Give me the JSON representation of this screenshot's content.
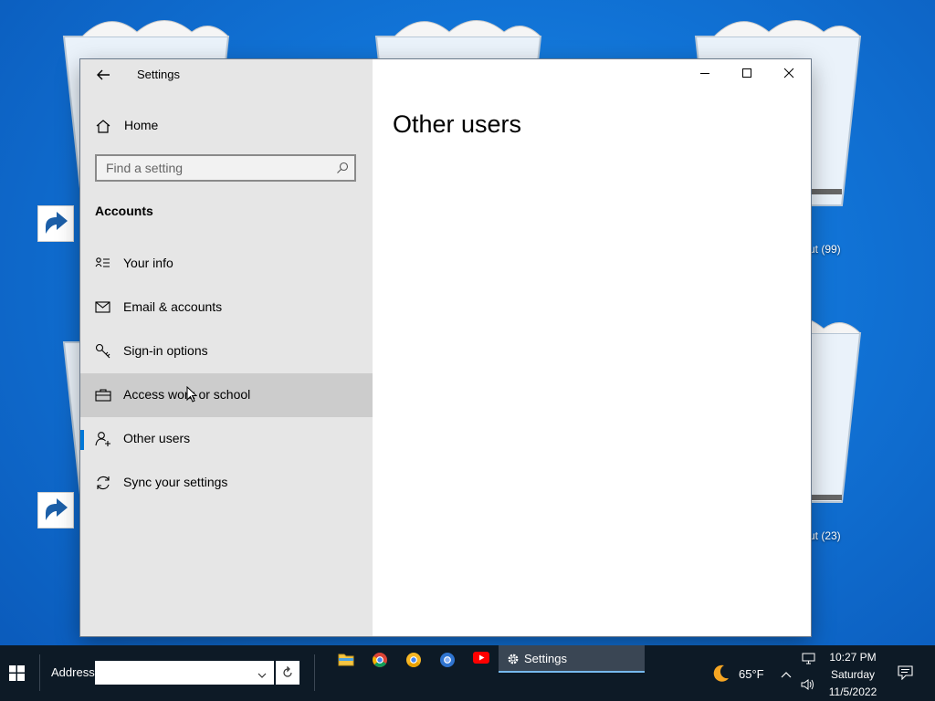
{
  "desktop": {
    "labels": [
      "ut (99)",
      "ut (23)"
    ]
  },
  "window": {
    "title": "Settings",
    "home_label": "Home",
    "search_placeholder": "Find a setting",
    "section_title": "Accounts",
    "nav_items": [
      {
        "label": "Your info",
        "icon": "person-card-icon"
      },
      {
        "label": "Email & accounts",
        "icon": "mail-icon"
      },
      {
        "label": "Sign-in options",
        "icon": "key-icon"
      },
      {
        "label": "Access work or school",
        "icon": "briefcase-icon"
      },
      {
        "label": "Other users",
        "icon": "add-person-icon"
      },
      {
        "label": "Sync your settings",
        "icon": "sync-icon"
      }
    ],
    "hovered_item": "Access work or school",
    "selected_item": "Other users",
    "page_title": "Other users",
    "accent_color": "#0078d7"
  },
  "taskbar": {
    "address_label": "Address",
    "address_value": "",
    "apps": [
      "file-explorer-icon",
      "chrome-icon",
      "chrome-canary-icon",
      "chromium-icon",
      "youtube-icon"
    ],
    "active_window_label": "Settings",
    "weather": "65°F",
    "time": "10:27 PM",
    "day": "Saturday",
    "date": "11/5/2022"
  }
}
